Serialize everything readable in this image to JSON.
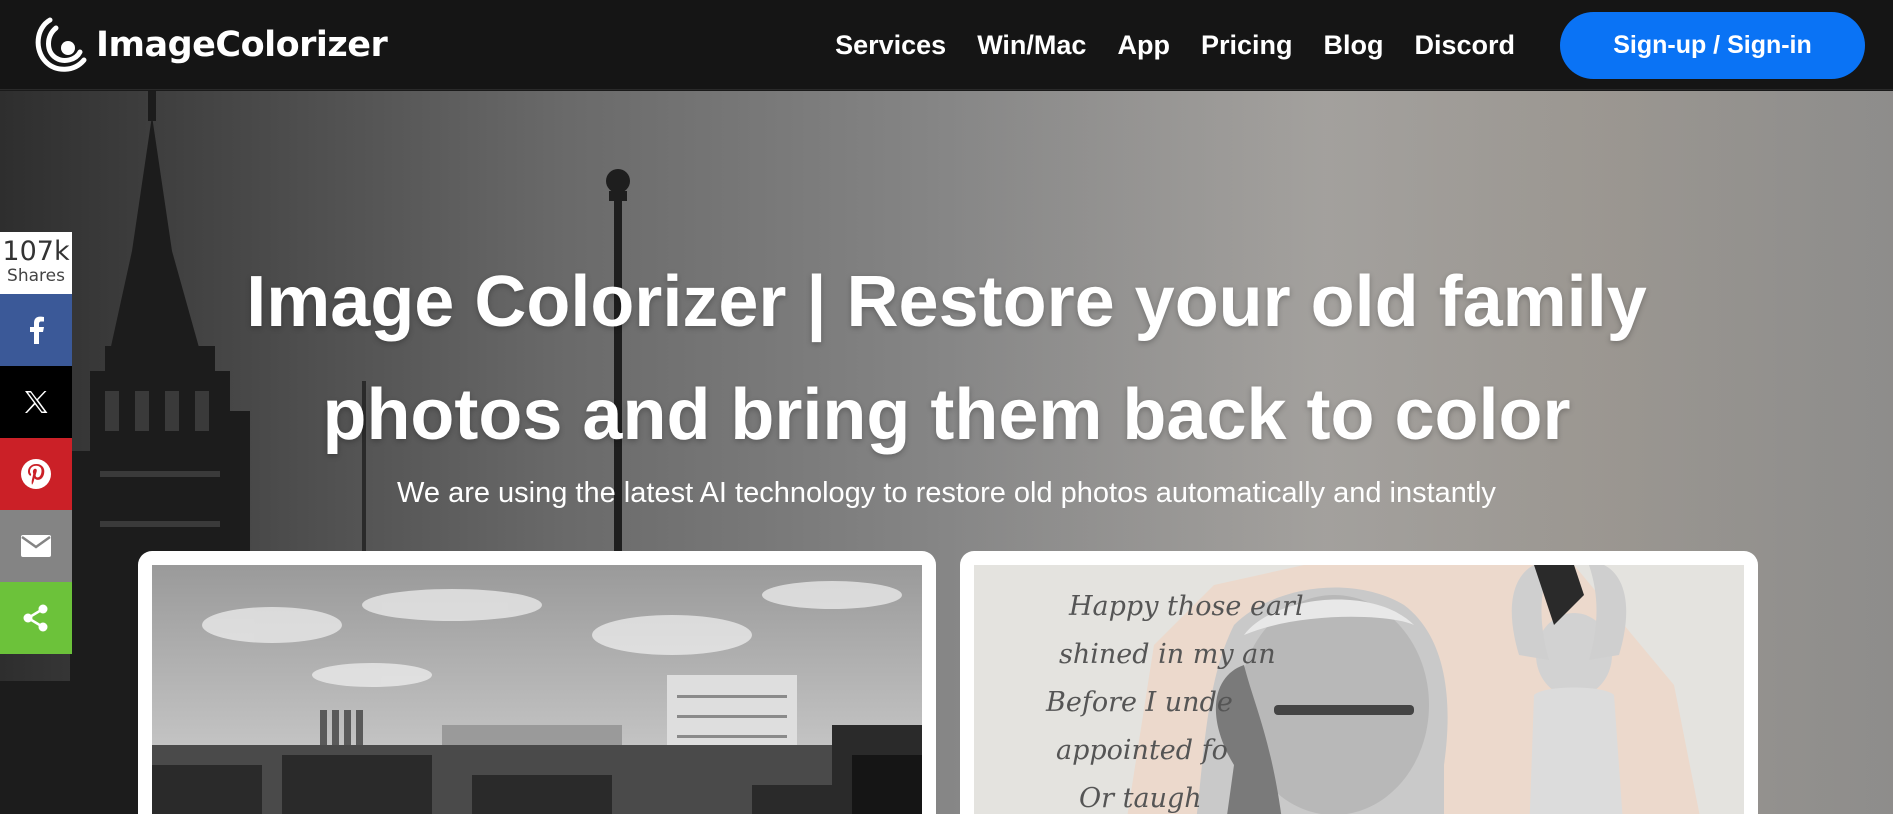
{
  "header": {
    "logo_text": "ImageColorizer",
    "nav": [
      {
        "label": "Services"
      },
      {
        "label": "Win/Mac"
      },
      {
        "label": "App"
      },
      {
        "label": "Pricing"
      },
      {
        "label": "Blog"
      },
      {
        "label": "Discord"
      }
    ],
    "signup_label": "Sign-up / Sign-in",
    "signup_color": "#0a73f5"
  },
  "hero": {
    "title_line1": "Image Colorizer | Restore your old family",
    "title_line2": "photos and bring them back to color",
    "subtitle": "We are using the latest AI technology to restore old photos automatically and instantly"
  },
  "social": {
    "count": "107k",
    "count_label": "Shares",
    "buttons": [
      {
        "icon": "facebook-icon",
        "color": "#3b5998"
      },
      {
        "icon": "x-icon",
        "color": "#000000"
      },
      {
        "icon": "pinterest-icon",
        "color": "#cb2027"
      },
      {
        "icon": "mail-icon",
        "color": "#848484"
      },
      {
        "icon": "share-icon",
        "color": "#6cc23a"
      }
    ]
  },
  "cards": {
    "right_poem": [
      "Happy those earl",
      "shined in my an",
      "Before I unde",
      "appointed fo",
      "Or taugh"
    ]
  }
}
